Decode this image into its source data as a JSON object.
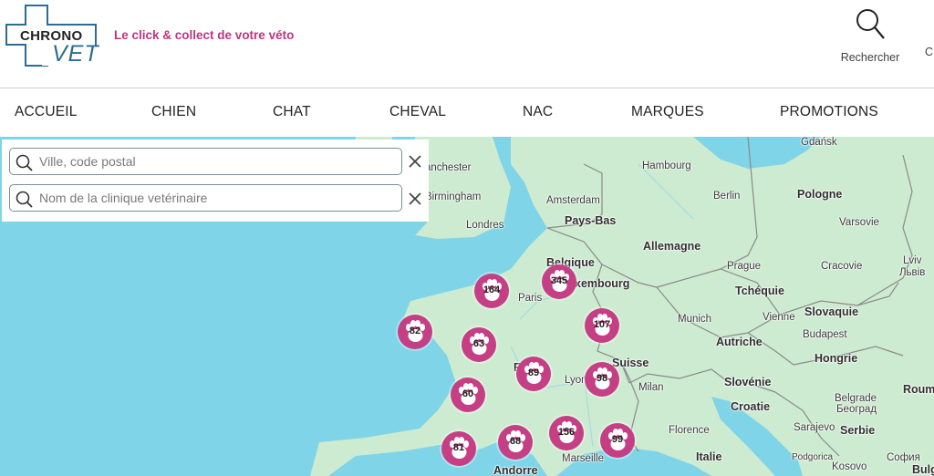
{
  "header": {
    "logo_top": "CHRONO",
    "logo_bottom": "VET",
    "tagline": "Le click & collect de votre véto",
    "search_label": "Rechercher",
    "search_icon": "search-icon",
    "cut_item": "C",
    "accent_color": "#c0347f",
    "logo_color": "#2b6d92"
  },
  "nav": {
    "items": [
      "ACCUEIL",
      "CHIEN",
      "CHAT",
      "CHEVAL",
      "NAC",
      "MARQUES",
      "PROMOTIONS"
    ]
  },
  "search": {
    "city_placeholder": "Ville, code postal",
    "city_value": "",
    "clinic_placeholder": "Nom de la clinique vetérinaire",
    "clinic_value": "",
    "clear_icon": "close-icon"
  },
  "map": {
    "places": [
      "Gdańsk",
      "anchester",
      "Hambourg",
      "Pologne",
      "Birmingham",
      "Amsterdam",
      "Berlin",
      "Varsovie",
      "Pays-Bas",
      "Londres",
      "Allemagne",
      "Lviv",
      "Львів",
      "Belgique",
      "Prague",
      "Cracovie",
      "xembourg",
      "Paris",
      "Tchéquie",
      "Vienne",
      "Slovaquie",
      "Munich",
      "Autriche",
      "Budapest",
      "Suisse",
      "Fr",
      "Lyon",
      "Hongrie",
      "Milan",
      "Slovénie",
      "Roum",
      "Croatie",
      "Belgrade",
      "Београд",
      "Florence",
      "Sarajevo",
      "Serbie",
      "Marseille",
      "Kosovo",
      "Italie",
      "Andorre",
      "Podgorica",
      "София",
      "Bulg"
    ],
    "markers": [
      {
        "count": "164"
      },
      {
        "count": "345"
      },
      {
        "count": "82"
      },
      {
        "count": "63"
      },
      {
        "count": "107"
      },
      {
        "count": "89"
      },
      {
        "count": "98"
      },
      {
        "count": "60"
      },
      {
        "count": "156"
      },
      {
        "count": "81"
      },
      {
        "count": "68"
      },
      {
        "count": "99"
      }
    ],
    "marker_icon": "paw-icon",
    "marker_color": "#c53f85",
    "sea_color": "#7fd4e8",
    "land_color": "#cdebd0"
  }
}
